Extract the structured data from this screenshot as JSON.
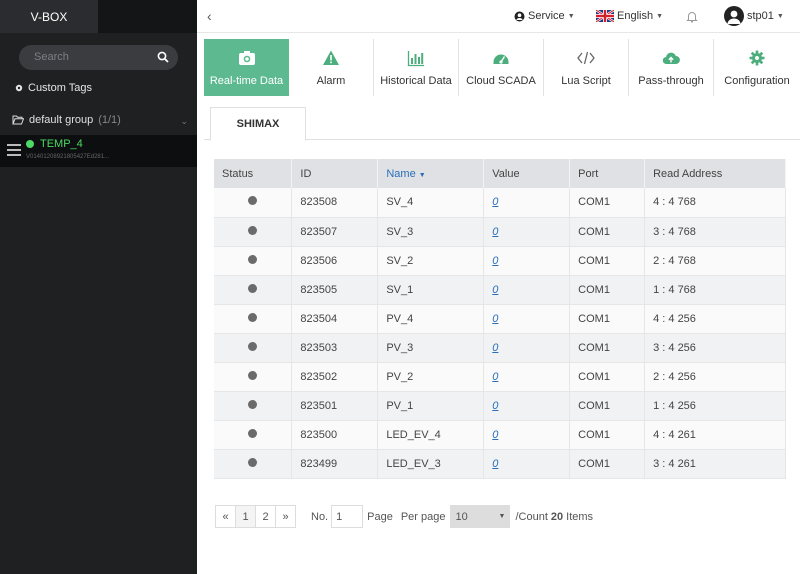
{
  "sidebar": {
    "brand": "V-BOX",
    "search_placeholder": "Search",
    "custom_tags": "Custom Tags",
    "group": {
      "name": "default group",
      "count": "(1/1)"
    },
    "device": {
      "name": "TEMP_4",
      "sub": "V01401208921805427Ed281..."
    }
  },
  "topbar": {
    "service": "Service",
    "language": "English",
    "user": "stp01"
  },
  "tabs": [
    {
      "label": "Real-time Data",
      "icon": "camera-icon"
    },
    {
      "label": "Alarm",
      "icon": "warning-icon"
    },
    {
      "label": "Historical Data",
      "icon": "bar-chart-icon"
    },
    {
      "label": "Cloud SCADA",
      "icon": "dashboard-icon"
    },
    {
      "label": "Lua Script",
      "icon": "code-icon"
    },
    {
      "label": "Pass-through",
      "icon": "cloud-upload-icon"
    },
    {
      "label": "Configuration",
      "icon": "gear-icon"
    }
  ],
  "subtab": "SHIMAX",
  "table": {
    "headers": [
      "Status",
      "ID",
      "Name",
      "Value",
      "Port",
      "Read Address"
    ],
    "rows": [
      {
        "id": "823508",
        "name": "SV_4",
        "value": "0",
        "port": "COM1",
        "addr": "4 : 4 768"
      },
      {
        "id": "823507",
        "name": "SV_3",
        "value": "0",
        "port": "COM1",
        "addr": "3 : 4 768"
      },
      {
        "id": "823506",
        "name": "SV_2",
        "value": "0",
        "port": "COM1",
        "addr": "2 : 4 768"
      },
      {
        "id": "823505",
        "name": "SV_1",
        "value": "0",
        "port": "COM1",
        "addr": "1 : 4 768"
      },
      {
        "id": "823504",
        "name": "PV_4",
        "value": "0",
        "port": "COM1",
        "addr": "4 : 4 256"
      },
      {
        "id": "823503",
        "name": "PV_3",
        "value": "0",
        "port": "COM1",
        "addr": "3 : 4 256"
      },
      {
        "id": "823502",
        "name": "PV_2",
        "value": "0",
        "port": "COM1",
        "addr": "2 : 4 256"
      },
      {
        "id": "823501",
        "name": "PV_1",
        "value": "0",
        "port": "COM1",
        "addr": "1 : 4 256"
      },
      {
        "id": "823500",
        "name": "LED_EV_4",
        "value": "0",
        "port": "COM1",
        "addr": "4 : 4 261"
      },
      {
        "id": "823499",
        "name": "LED_EV_3",
        "value": "0",
        "port": "COM1",
        "addr": "3 : 4 261"
      }
    ]
  },
  "pager": {
    "prev": "«",
    "pages": [
      "1",
      "2"
    ],
    "next": "»",
    "no_label": "No.",
    "no_value": "1",
    "page_label": "Page",
    "per_page_label": "Per page",
    "per_page_value": "10",
    "count_prefix": "/Count",
    "count_value": "20",
    "count_suffix": "Items"
  },
  "colors": {
    "accent": "#5dba90",
    "link": "#2a6fb9",
    "online": "#4cd964"
  }
}
